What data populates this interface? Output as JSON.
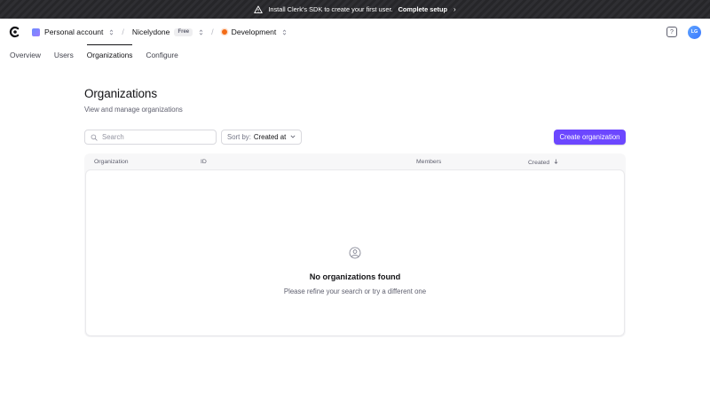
{
  "banner": {
    "text": "Install Clerk's SDK to create your first user.",
    "link": "Complete setup",
    "chevron": "›"
  },
  "header": {
    "account": "Personal account",
    "app_name": "Nicelydone",
    "plan_badge": "Free",
    "environment": "Development",
    "help_label": "?",
    "avatar_initials": "LG",
    "separator": "/"
  },
  "tabs": [
    {
      "label": "Overview"
    },
    {
      "label": "Users"
    },
    {
      "label": "Organizations",
      "active": true
    },
    {
      "label": "Configure"
    }
  ],
  "main": {
    "title": "Organizations",
    "subtitle": "View and manage organizations",
    "search_placeholder": "Search",
    "sort_label": "Sort by:",
    "sort_value": "Created at",
    "create_button": "Create organization"
  },
  "table": {
    "columns": [
      "Organization",
      "ID",
      "Members",
      "Created"
    ],
    "sort_column": "Created",
    "empty_title": "No organizations found",
    "empty_subtitle": "Please refine your search or try a different one"
  },
  "colors": {
    "accent": "#6c47ff",
    "dev_dot": "#f36b16",
    "banner_bg": "#2a2a2e"
  },
  "icons": [
    "warning-icon",
    "clerk-logo-icon",
    "updown-chevron-icon",
    "help-icon",
    "search-icon",
    "chevron-down-icon",
    "arrow-down-icon",
    "user-circle-icon"
  ]
}
